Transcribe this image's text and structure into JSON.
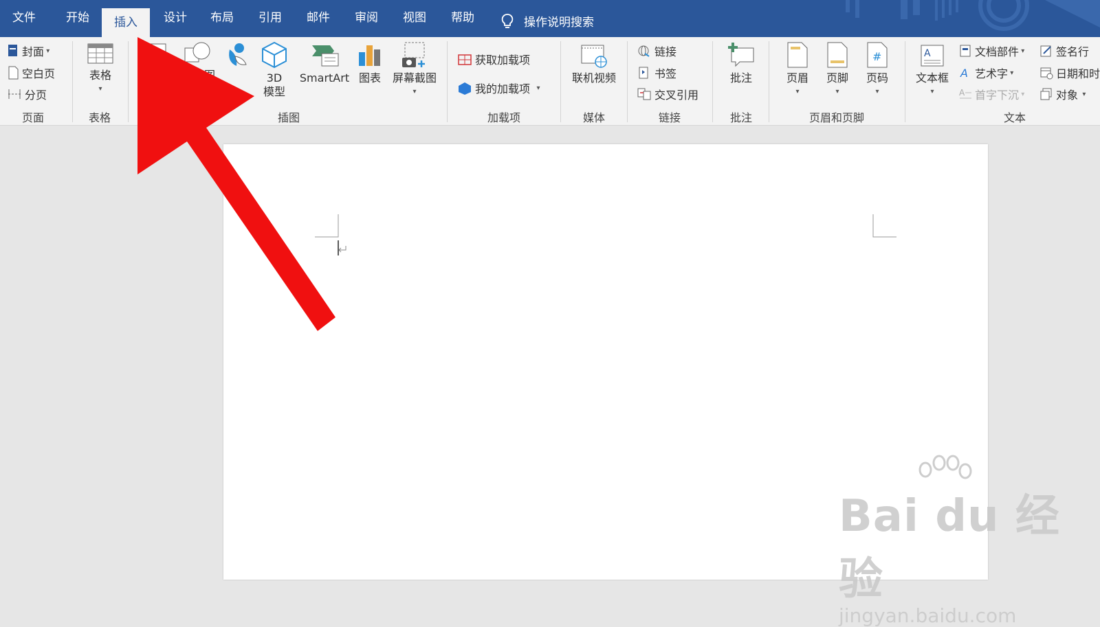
{
  "tabs": [
    "文件",
    "开始",
    "插入",
    "设计",
    "布局",
    "引用",
    "邮件",
    "审阅",
    "视图",
    "帮助"
  ],
  "active_tab": "插入",
  "tell_me": "操作说明搜索",
  "ribbon": {
    "pages": {
      "cover": "封面",
      "blank": "空白页",
      "break": "分页",
      "label": "页面"
    },
    "tables": {
      "table": "表格",
      "label": "表格"
    },
    "illustrations": {
      "pictures_partial": "图",
      "model_line1": "3D",
      "model_line2": "模型",
      "smartart": "SmartArt",
      "chart": "图表",
      "screenshot": "屏幕截图",
      "label": "插图"
    },
    "addins": {
      "get": "获取加载项",
      "mine": "我的加载项",
      "label": "加载项"
    },
    "media": {
      "video": "联机视频",
      "label": "媒体"
    },
    "links": {
      "link": "链接",
      "bookmark": "书签",
      "crossref": "交叉引用",
      "label": "链接"
    },
    "comments": {
      "comment": "批注",
      "label": "批注"
    },
    "headerfooter": {
      "header": "页眉",
      "footer": "页脚",
      "pagenum": "页码",
      "label": "页眉和页脚"
    },
    "text": {
      "textbox": "文本框",
      "parts": "文档部件",
      "wordart": "艺术字",
      "dropcap": "首字下沉",
      "signature": "签名行",
      "datetime": "日期和时",
      "object": "对象",
      "label": "文本"
    }
  },
  "watermark": {
    "brand": "Bai du 经验",
    "url": "jingyan.baidu.com"
  },
  "colors": {
    "titlebar": "#2b579a",
    "ribbon": "#f3f3f3",
    "arrow": "#f01010"
  }
}
